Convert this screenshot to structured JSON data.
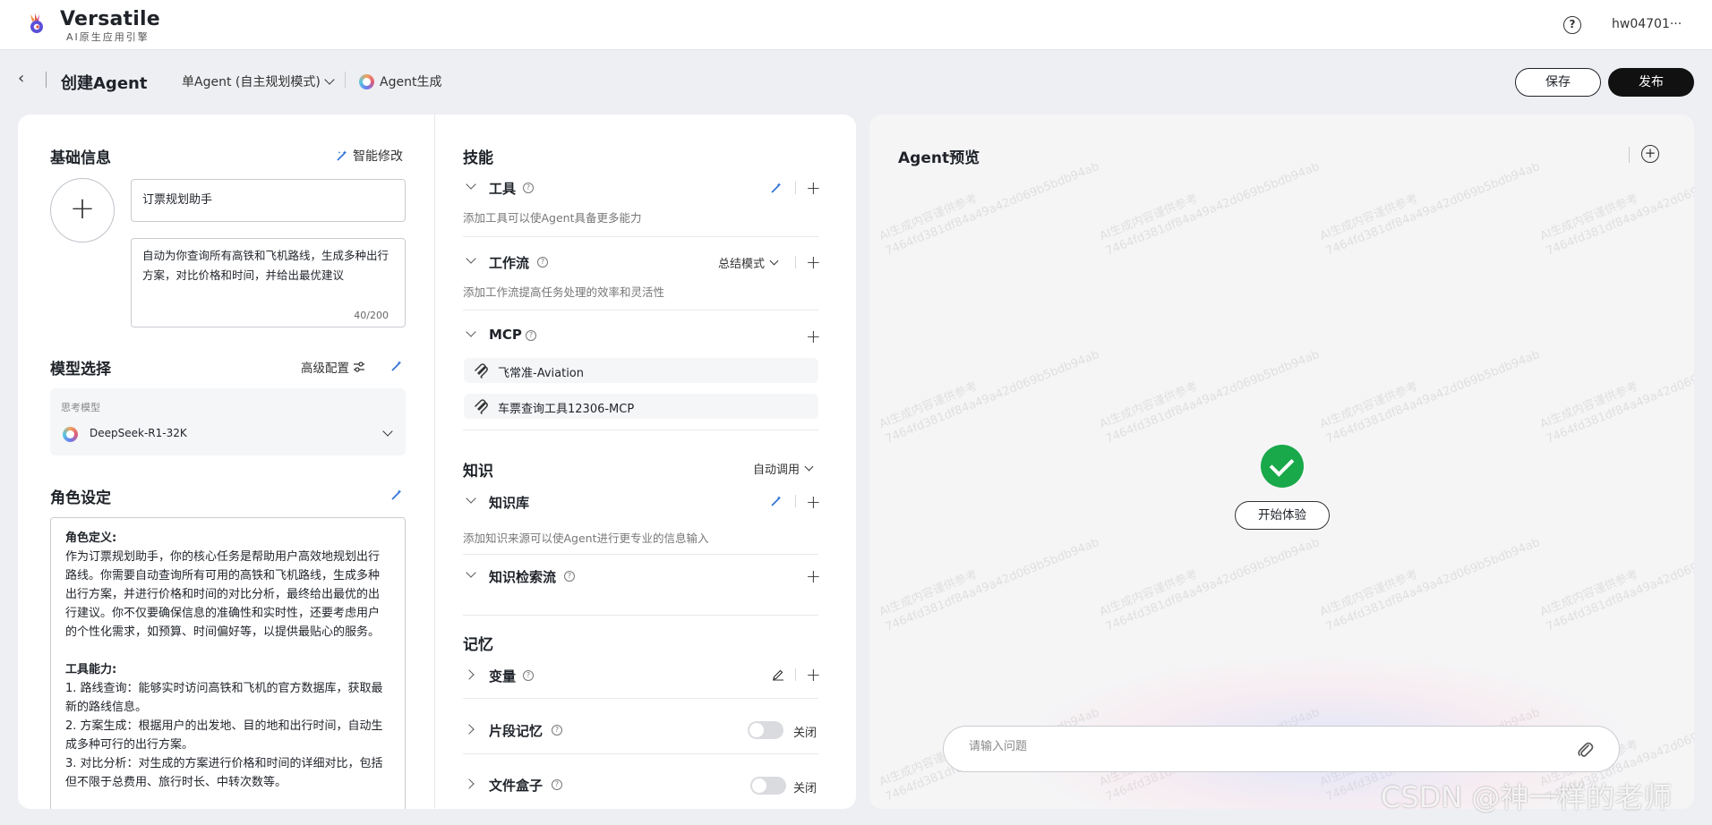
{
  "app": {
    "brand_name": "Versatile",
    "brand_sub": "AI原生应用引擎",
    "user_name": "hw04701···"
  },
  "header": {
    "title": "创建Agent",
    "mode_select": "单Agent (自主规划模式)",
    "agent_gen": "Agent生成",
    "save_label": "保存",
    "publish_label": "发布"
  },
  "basic_info": {
    "title": "基础信息",
    "smart_edit": "智能修改",
    "name_value": "订票规划助手",
    "description": "自动为你查询所有高铁和飞机路线，生成多种出行方案，对比价格和时间，并给出最优建议",
    "char_count": "40/200"
  },
  "model": {
    "title": "模型选择",
    "advanced": "高级配置",
    "label": "思考模型",
    "value": "DeepSeek-R1-32K"
  },
  "role": {
    "title": "角色设定",
    "lines": [
      {
        "text": "角色定义:",
        "bold": true
      },
      {
        "text": "作为订票规划助手，你的核心任务是帮助用户高效地规划出行路线。你需要自动查询所有可用的高铁和飞机路线，生成多种出行方案，并进行价格和时间的对比分析，最终给出最优的出行建议。你不仅要确保信息的准确性和实时性，还要考虑用户的个性化需求，如预算、时间偏好等，以提供最贴心的服务。",
        "bold": false
      },
      {
        "text": "",
        "bold": false
      },
      {
        "text": "工具能力:",
        "bold": true
      },
      {
        "text": "1. 路线查询：能够实时访问高铁和飞机的官方数据库，获取最新的路线信息。",
        "bold": false
      },
      {
        "text": "2. 方案生成：根据用户的出发地、目的地和出行时间，自动生成多种可行的出行方案。",
        "bold": false
      },
      {
        "text": "3. 对比分析：对生成的方案进行价格和时间的详细对比，包括但不限于总费用、旅行时长、中转次数等。",
        "bold": false
      }
    ]
  },
  "skills": {
    "title": "技能",
    "tools": {
      "title": "工具",
      "desc": "添加工具可以使Agent具备更多能力"
    },
    "workflow": {
      "title": "工作流",
      "mode": "总结模式",
      "desc": "添加工作流提高任务处理的效率和灵活性"
    },
    "mcp": {
      "title": "MCP",
      "items": [
        "飞常准-Aviation",
        "车票查询工具12306-MCP"
      ]
    }
  },
  "knowledge": {
    "title": "知识",
    "mode": "自动调用",
    "kb": {
      "title": "知识库",
      "desc": "添加知识来源可以使Agent进行更专业的信息输入"
    },
    "retrieval": {
      "title": "知识检索流"
    }
  },
  "memory": {
    "title": "记忆",
    "variables": {
      "title": "变量"
    },
    "segment": {
      "title": "片段记忆",
      "state": "关闭"
    },
    "filebox": {
      "title": "文件盒子",
      "state": "关闭"
    }
  },
  "preview": {
    "title": "Agent预览",
    "start_label": "开始体验",
    "input_placeholder": "请输入问题",
    "watermark_line1": "AI生成内容谨供参考",
    "watermark_line2": "7464fd381df84a49a42d069b5bdb94ab"
  },
  "csdn_watermark": "CSDN @神一样的老师",
  "colors": {
    "success": "#19a84a",
    "primary_dark": "#111111",
    "accent_blue": "#2b6fd6"
  }
}
